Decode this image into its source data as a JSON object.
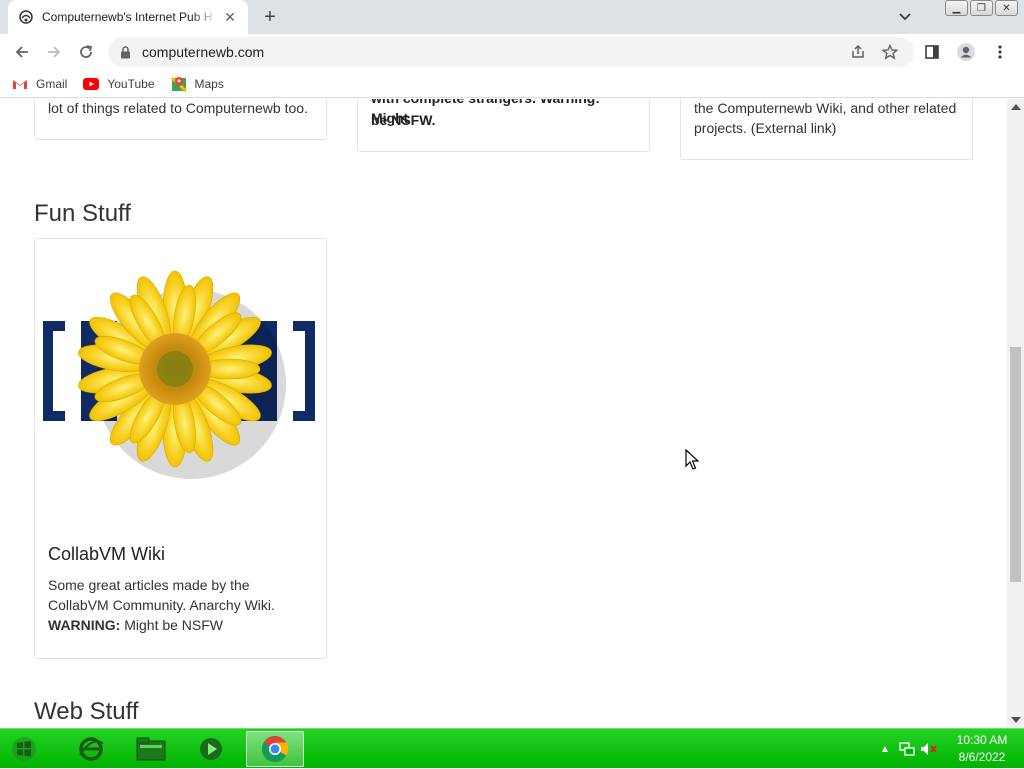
{
  "browser": {
    "tab_title": "Computernewb's Internet Pub H",
    "url": "computernewb.com",
    "bookmarks": [
      {
        "label": "Gmail",
        "icon": "gmail-icon"
      },
      {
        "label": "YouTube",
        "icon": "youtube-icon"
      },
      {
        "label": "Maps",
        "icon": "maps-icon"
      }
    ]
  },
  "page": {
    "top_cards": [
      {
        "text_plain": "lot of things related to Computernewb too."
      },
      {
        "text_prefix": "with complete strangers.",
        "warning_fragment": "Warning: Might be NSFW.",
        "line1_partial": "with complete strangers. Warning: Might",
        "line2_bold": "be NSFW."
      },
      {
        "line1": "the Computernewb Wiki, and other related",
        "line2": "projects. (External link)"
      }
    ],
    "fun_stuff_heading": "Fun Stuff",
    "collabvm_card": {
      "title": "CollabVM Wiki",
      "line1": "Some great articles made by the",
      "line2": "CollabVM Community. Anarchy Wiki.",
      "warning_label": "WARNING:",
      "warning_text": " Might be NSFW"
    },
    "web_stuff_heading": "Web Stuff"
  },
  "taskbar": {
    "time": "10:30 AM",
    "date": "8/6/2022"
  },
  "colors": {
    "taskbar": "#00b300",
    "chrome_frame": "#dee1e6"
  }
}
